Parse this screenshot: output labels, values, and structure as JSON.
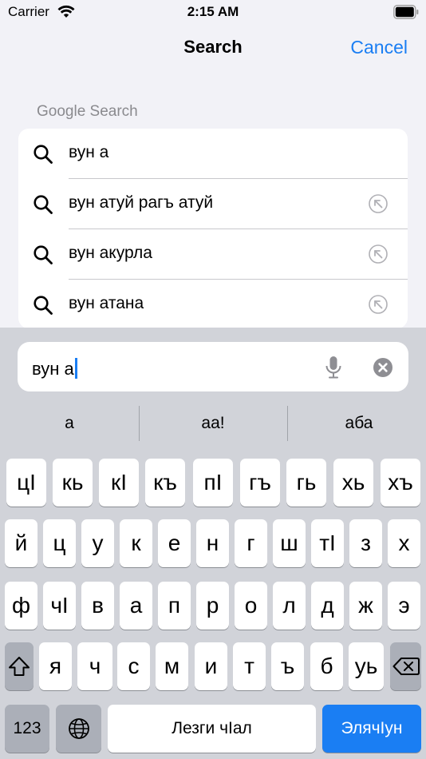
{
  "status_bar": {
    "carrier": "Carrier",
    "time": "2:15 AM"
  },
  "nav": {
    "title": "Search",
    "cancel_label": "Cancel"
  },
  "section_header": "Google Search",
  "suggestions": [
    {
      "text": "вун а",
      "fill_icon": false
    },
    {
      "text": "вун атуй рагъ атуй",
      "fill_icon": true
    },
    {
      "text": "вун акурла",
      "fill_icon": true
    },
    {
      "text": "вун атана",
      "fill_icon": true
    }
  ],
  "search_field": {
    "value": "вун а"
  },
  "predictions": [
    "a",
    "aa!",
    "aба"
  ],
  "keyboard": {
    "row1": [
      "цӀ",
      "кь",
      "кӀ",
      "къ",
      "пӀ",
      "гъ",
      "гь",
      "хь",
      "хъ"
    ],
    "row2": [
      "й",
      "ц",
      "у",
      "к",
      "е",
      "н",
      "г",
      "ш",
      "тӀ",
      "з",
      "х"
    ],
    "row3": [
      "ф",
      "чӀ",
      "в",
      "а",
      "п",
      "р",
      "о",
      "л",
      "д",
      "ж",
      "э"
    ],
    "row4": [
      "я",
      "ч",
      "с",
      "м",
      "и",
      "т",
      "ъ",
      "б",
      "уь"
    ],
    "numbers_label": "123",
    "space_label": "Лезги чӀал",
    "return_label": "ЭлячӀун"
  },
  "colors": {
    "accent": "#1a7ef3",
    "keyboard_bg": "#d1d3d9",
    "background": "#f2f2f7"
  }
}
